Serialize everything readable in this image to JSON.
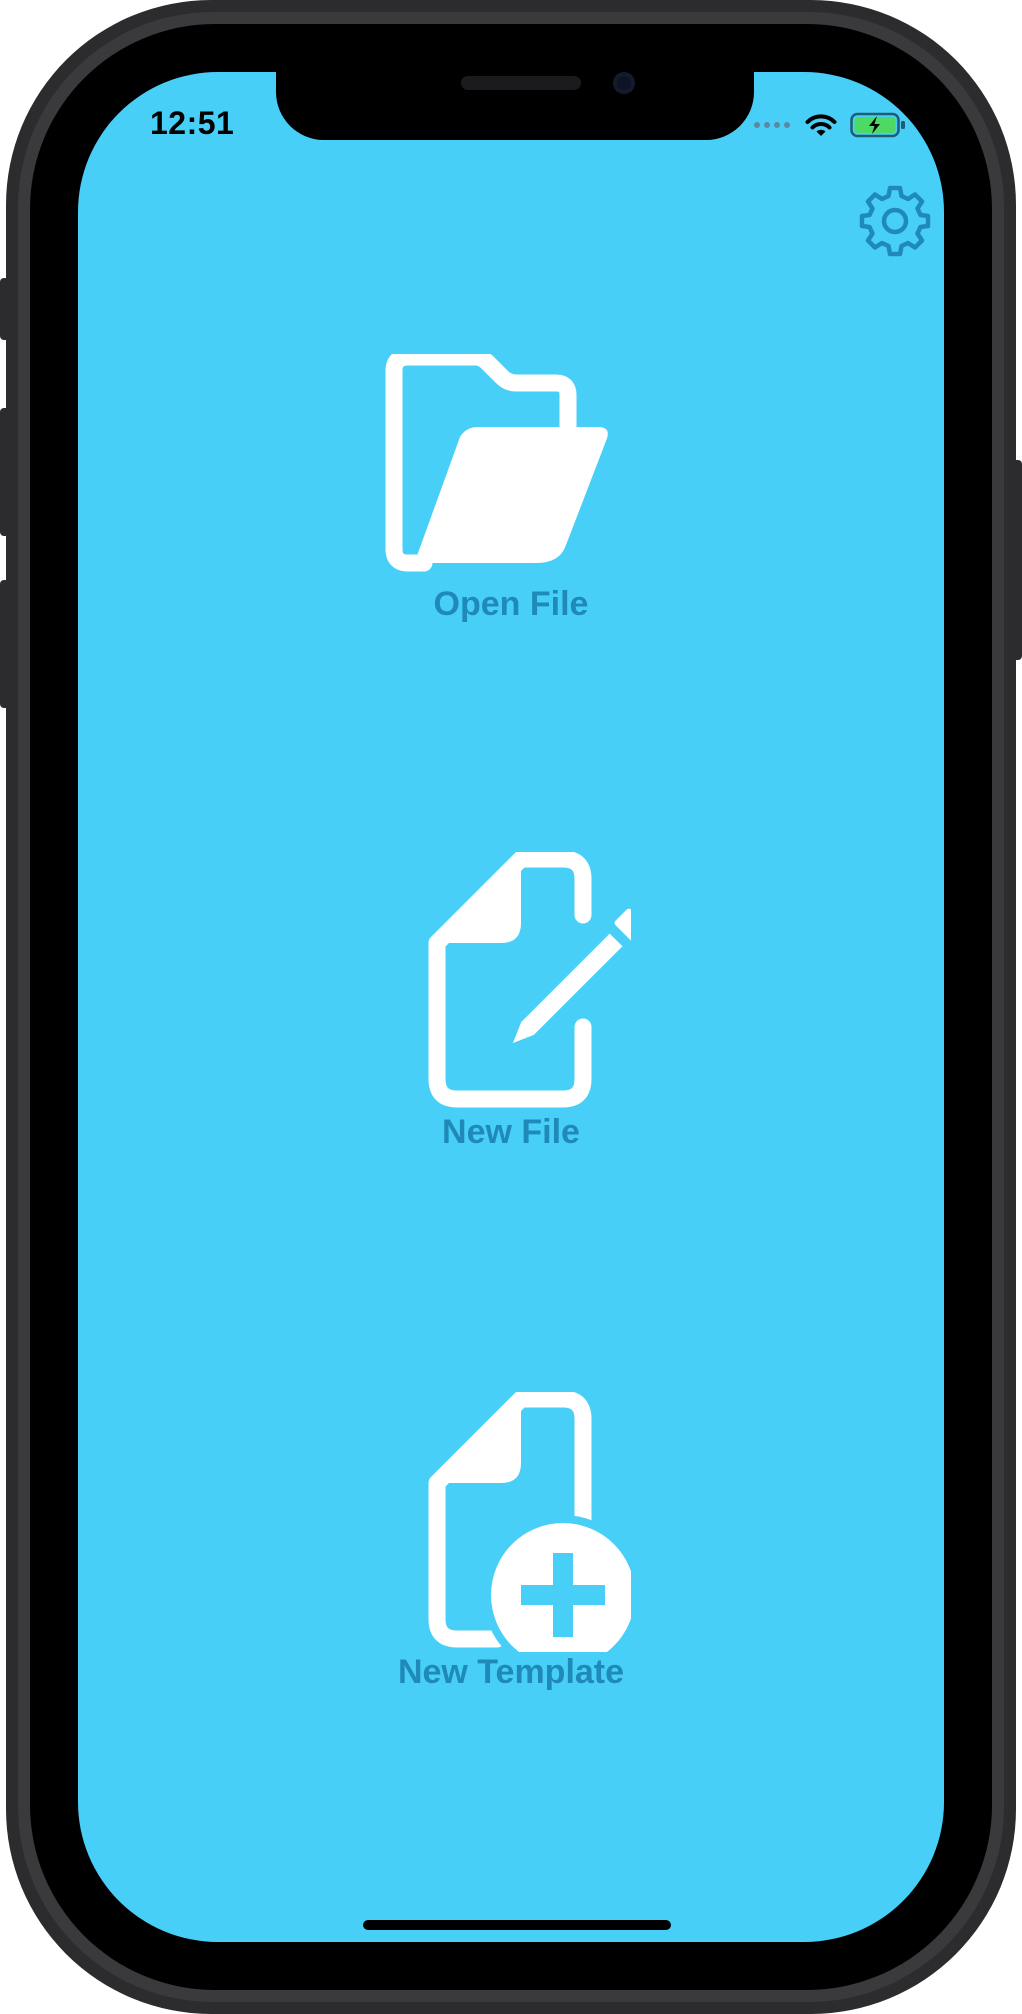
{
  "status_bar": {
    "time": "12:51",
    "wifi_icon": "wifi-icon",
    "battery_icon": "battery-charging-icon"
  },
  "toolbar": {
    "settings_icon": "gear-icon"
  },
  "menu": {
    "items": [
      {
        "label": "Open File",
        "icon": "folder-open-icon"
      },
      {
        "label": "New File",
        "icon": "document-edit-icon"
      },
      {
        "label": "New Template",
        "icon": "document-add-icon"
      }
    ]
  },
  "colors": {
    "background": "#48cff8",
    "label": "#1f8ab8",
    "icon_fill": "#ffffff",
    "battery_fill": "#4cd964"
  }
}
